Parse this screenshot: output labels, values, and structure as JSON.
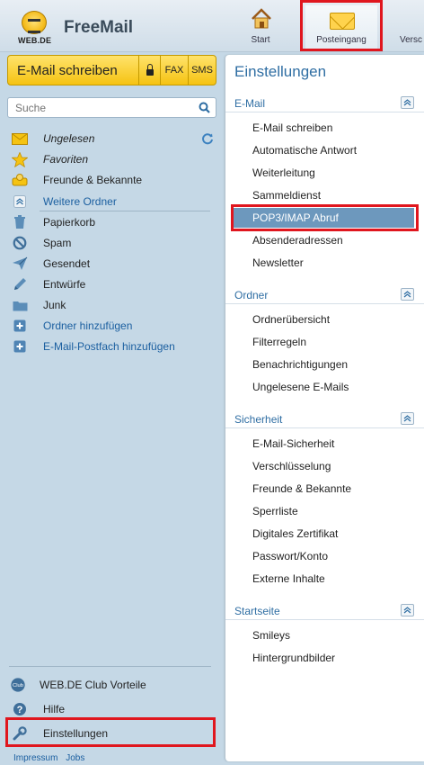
{
  "header": {
    "logo_text": "WEB.DE",
    "brand": "FreeMail",
    "nav": [
      {
        "label": "Start"
      },
      {
        "label": "Posteingang"
      },
      {
        "label": "Versc"
      }
    ]
  },
  "sidebar": {
    "compose": {
      "label": "E-Mail schreiben",
      "fax": "FAX",
      "sms": "SMS"
    },
    "search": {
      "placeholder": "Suche"
    },
    "folders": [
      {
        "label": "Ungelesen",
        "icon": "envelope-icon"
      },
      {
        "label": "Favoriten",
        "icon": "star-icon"
      },
      {
        "label": "Freunde & Bekannte",
        "icon": "friends-icon"
      },
      {
        "label": "Weitere Ordner",
        "icon": "collapse-icon"
      },
      {
        "label": "Papierkorb",
        "icon": "trash-icon"
      },
      {
        "label": "Spam",
        "icon": "spam-icon"
      },
      {
        "label": "Gesendet",
        "icon": "sent-icon"
      },
      {
        "label": "Entwürfe",
        "icon": "pencil-icon"
      },
      {
        "label": "Junk",
        "icon": "folder-icon"
      },
      {
        "label": "Ordner hinzufügen",
        "icon": "plus-icon"
      },
      {
        "label": "E-Mail-Postfach hinzufügen",
        "icon": "plus-icon"
      }
    ],
    "bottom": [
      {
        "label": "WEB.DE Club Vorteile",
        "icon": "club-icon",
        "icon_text": "Club"
      },
      {
        "label": "Hilfe",
        "icon": "help-icon"
      },
      {
        "label": "Einstellungen",
        "icon": "wrench-icon"
      }
    ],
    "footer": {
      "impressum": "Impressum",
      "jobs": "Jobs"
    }
  },
  "settings": {
    "title": "Einstellungen",
    "sections": [
      {
        "label": "E-Mail",
        "items": [
          "E-Mail schreiben",
          "Automatische Antwort",
          "Weiterleitung",
          "Sammeldienst",
          "POP3/IMAP Abruf",
          "Absenderadressen",
          "Newsletter"
        ]
      },
      {
        "label": "Ordner",
        "items": [
          "Ordnerübersicht",
          "Filterregeln",
          "Benachrichtigungen",
          "Ungelesene E-Mails"
        ]
      },
      {
        "label": "Sicherheit",
        "items": [
          "E-Mail-Sicherheit",
          "Verschlüsselung",
          "Freunde & Bekannte",
          "Sperrliste",
          "Digitales Zertifikat",
          "Passwort/Konto",
          "Externe Inhalte"
        ]
      },
      {
        "label": "Startseite",
        "items": [
          "Smileys",
          "Hintergrundbilder"
        ]
      }
    ],
    "active_item": "POP3/IMAP Abruf"
  },
  "colors": {
    "highlight": "#e0161e",
    "accent": "#2f6ea3",
    "active_item_bg": "#6d98bd",
    "compose_yellow": "#f5c312"
  }
}
